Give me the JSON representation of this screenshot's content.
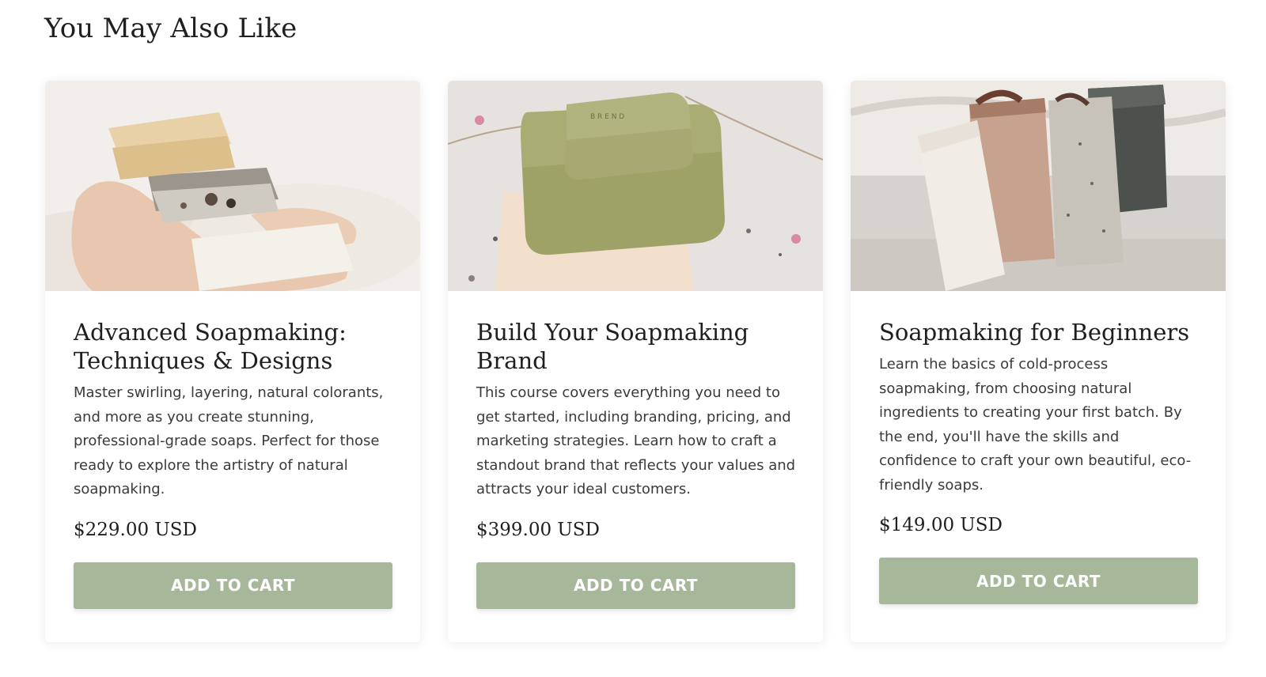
{
  "section": {
    "title": "You May Also Like"
  },
  "products": [
    {
      "title": "Advanced Soapmaking: Techniques & Designs",
      "description": "Master swirling, layering, natural colorants, and more as you create stunning, professional-grade soaps. Perfect for those ready to explore the artistry of natural soapmaking.",
      "price": "$229.00 USD",
      "button_label": "ADD TO CART"
    },
    {
      "title": "Build Your Soapmaking Brand",
      "description": "This course covers everything you need to get started, including branding, pricing, and marketing strategies. Learn how to craft a standout brand that reflects your values and attracts your ideal customers.",
      "price": "$399.00 USD",
      "button_label": "ADD TO CART"
    },
    {
      "title": "Soapmaking for Beginners",
      "description": "Learn the basics of cold-process soapmaking, from choosing natural ingredients to creating your first batch. By the end, you'll have the skills and confidence to craft your own beautiful, eco-friendly soaps.",
      "price": "$149.00 USD",
      "button_label": "ADD TO CART"
    }
  ],
  "colors": {
    "button_bg": "#a7b79a",
    "button_text": "#ffffff",
    "title_text": "#1f1f1f",
    "body_text": "#3a3a3a"
  }
}
